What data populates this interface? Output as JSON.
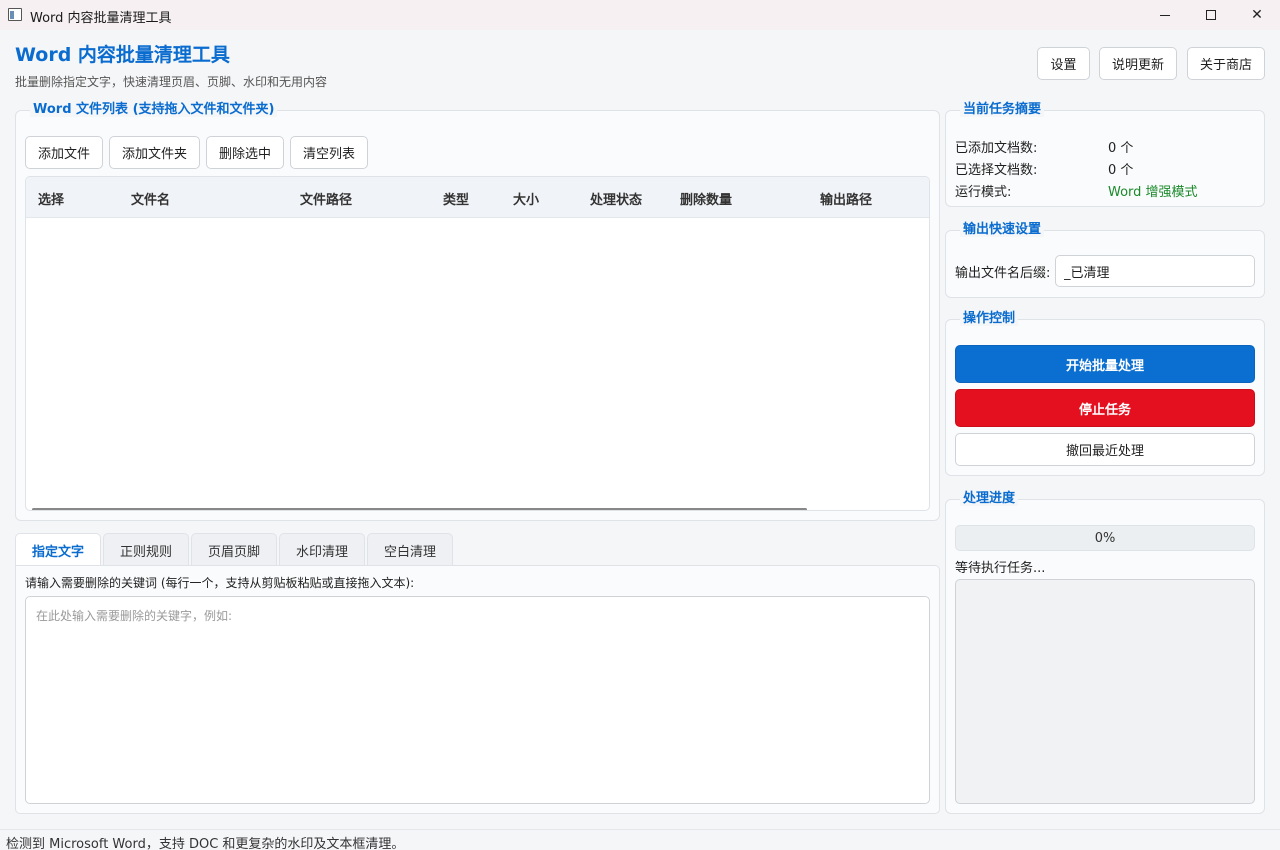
{
  "window": {
    "title": "Word 内容批量清理工具",
    "min_icon": "minimize-icon",
    "max_icon": "maximize-icon",
    "close_icon": "close-icon"
  },
  "header": {
    "title": "Word 内容批量清理工具",
    "subtitle": "批量删除指定文字，快速清理页眉、页脚、水印和无用内容",
    "buttons": [
      "设置",
      "说明更新",
      "关于商店"
    ]
  },
  "file_list": {
    "title": "Word 文件列表 (支持拖入文件和文件夹)",
    "buttons": [
      "添加文件",
      "添加文件夹",
      "删除选中",
      "清空列表"
    ],
    "columns": [
      "选择",
      "文件名",
      "文件路径",
      "类型",
      "大小",
      "处理状态",
      "删除数量",
      "输出路径"
    ],
    "rows": []
  },
  "tabs": {
    "items": [
      "指定文字",
      "正则规则",
      "页眉页脚",
      "水印清理",
      "空白清理"
    ],
    "active": "指定文字",
    "description": "请输入需要删除的关键词 (每行一个，支持从剪贴板粘贴或直接拖入文本):",
    "placeholder": "在此处输入需要删除的关键字，例如:",
    "value": ""
  },
  "summary": {
    "title": "当前任务摘要",
    "added_label": "已添加文档数:",
    "added_value": "0 个",
    "selected_label": "已选择文档数:",
    "selected_value": "0 个",
    "mode_label": "运行模式:",
    "mode_value": "Word 增强模式",
    "mode_color": "#1a8a2a"
  },
  "output": {
    "title": "输出快速设置",
    "suffix_label": "输出文件名后缀:",
    "suffix_value": "_已清理"
  },
  "controls": {
    "title": "操作控制",
    "start": "开始批量处理",
    "stop": "停止任务",
    "undo": "撤回最近处理",
    "start_color": "#0a6fd0",
    "stop_color": "#e4101f"
  },
  "progress": {
    "title": "处理进度",
    "value": 0,
    "text": "0%",
    "status": "等待执行任务..."
  },
  "statusbar": {
    "text": "检测到 Microsoft Word，支持 DOC 和更复杂的水印及文本框清理。"
  },
  "colors": {
    "accent": "#0a6ccf"
  }
}
